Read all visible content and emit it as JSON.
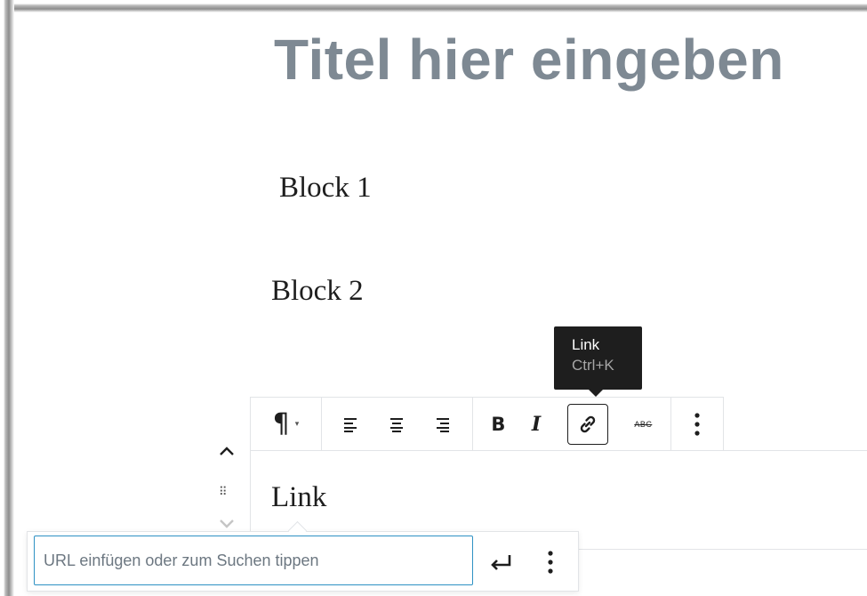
{
  "editor": {
    "title": "Titel hier eingeben",
    "blocks": [
      {
        "text": "Block 1"
      },
      {
        "text": "Block 2"
      },
      {
        "text": "Link"
      }
    ]
  },
  "tooltip": {
    "label": "Link",
    "shortcut": "Ctrl+K"
  },
  "toolbar": {
    "paragraph_icon": "¶",
    "dropdown_icon": "▾",
    "align_icons": [
      "align-left-icon",
      "align-center-icon",
      "align-right-icon"
    ],
    "bold": "B",
    "italic": "I",
    "strikethrough": "ABC",
    "link_icon": "link-icon",
    "more_icon": "more-vertical-icon"
  },
  "link_popover": {
    "placeholder": "URL einfügen oder zum Suchen tippen",
    "value": "",
    "submit_icon": "enter-icon",
    "more_icon": "more-vertical-icon"
  },
  "colors": {
    "title": "#7e8993",
    "text": "#1e1e1e",
    "border": "#e2e4e7",
    "focus": "#2e91c4",
    "tooltip_bg": "#1e1e1e"
  }
}
